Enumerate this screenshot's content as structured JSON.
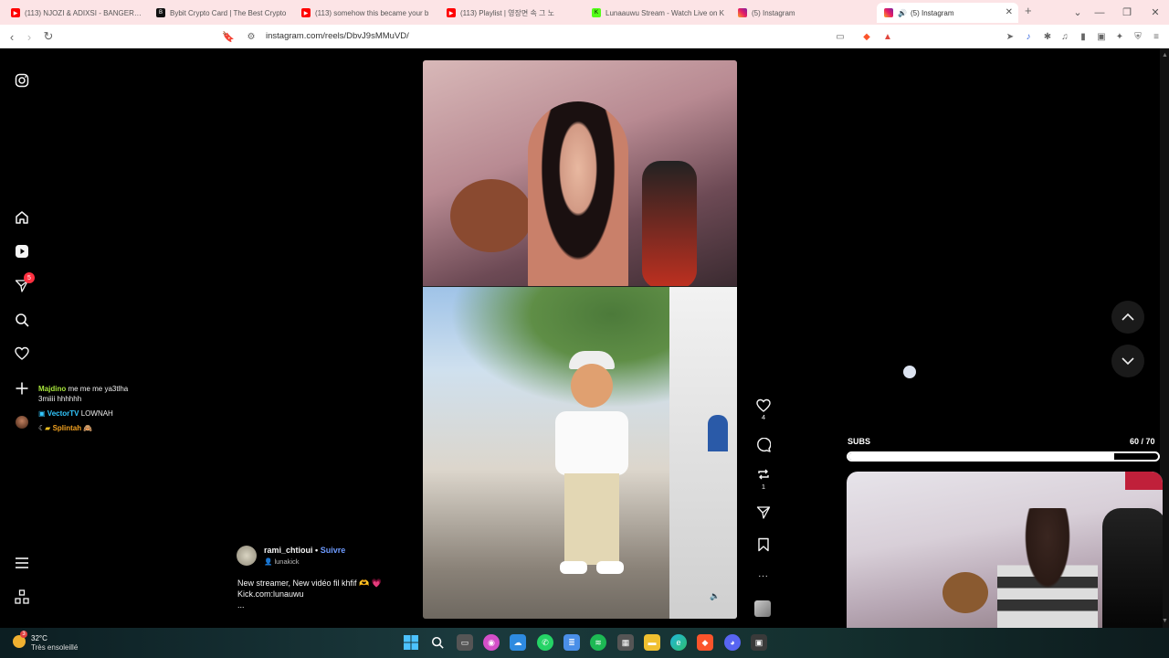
{
  "browser": {
    "tabs": [
      {
        "title": "(113) NJOZI & ADIXSI - BANGERS C",
        "icon": "youtube-icon"
      },
      {
        "title": "Bybit Crypto Card | The Best Crypto",
        "icon": "bybit-icon"
      },
      {
        "title": "(113) somehow this became your b",
        "icon": "youtube-icon"
      },
      {
        "title": "(113) Playlist | 영장면 속 그 노",
        "icon": "youtube-icon"
      },
      {
        "title": "Lunaauwu Stream - Watch Live on K",
        "icon": "kick-icon"
      },
      {
        "title": "(5) Instagram",
        "icon": "instagram-icon"
      },
      {
        "title": "(5) Instagram",
        "icon": "instagram-icon",
        "active": true
      }
    ],
    "new_tab": "+",
    "url": "instagram.com/reels/DbvJ9sMMuVD/"
  },
  "instagram": {
    "sidebar": {
      "notifications_badge": "5"
    },
    "chat": [
      {
        "user": "Majdino",
        "text": "me me me ya3tlha"
      },
      {
        "user": "",
        "text": "3miiii hhhhhh"
      },
      {
        "user": "VectorTV",
        "text": "LOWNAH"
      },
      {
        "user": "Splintah",
        "text": ""
      }
    ],
    "reel": {
      "author": "rami_chtioui",
      "separator": "•",
      "follow": "Suivre",
      "audio": "lunakick",
      "caption_line1": "New streamer, New vidéo fil khfif 🫶 💗",
      "caption_line2": "Kick.com:lunauwu",
      "caption_more": "..."
    },
    "actions": {
      "likes": "4",
      "reposts": "1",
      "more": "..."
    }
  },
  "stream_overlay": {
    "subs_label": "SUBS",
    "subs_count": "60 / 70",
    "subs_progress": 0.857
  },
  "taskbar": {
    "temperature": "32°C",
    "weather": "Très ensoleillé",
    "weather_badge": "3"
  },
  "colors": {
    "tab_strip": "#fce4e6",
    "follow": "#6e9bff",
    "notification": "#ff3040"
  }
}
